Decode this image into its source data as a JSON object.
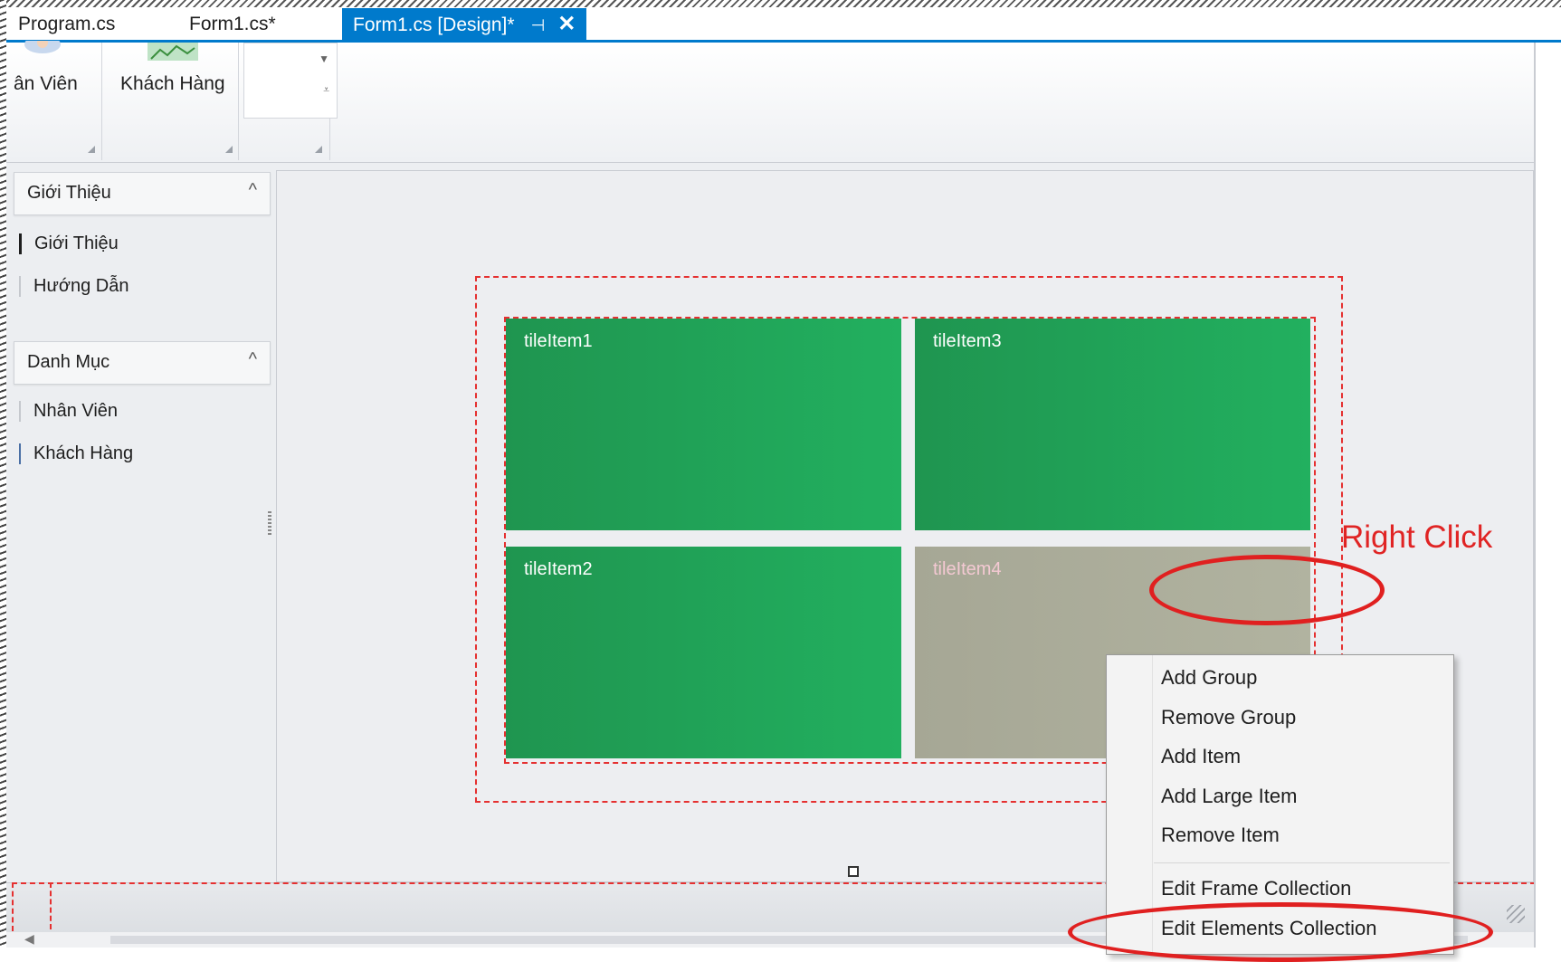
{
  "tabs": [
    {
      "label": "Program.cs"
    },
    {
      "label": "Form1.cs*"
    },
    {
      "label": "Form1.cs [Design]*",
      "pin_icon": "⊣",
      "close_icon": "✕"
    }
  ],
  "ribbon": {
    "button1_label": "ân Viên",
    "button2_label": "Khách Hàng",
    "gallery_up_icon": "▼",
    "gallery_more_icon": "⩡"
  },
  "nav": {
    "groups": [
      {
        "label": "Giới Thiệu",
        "collapse_icon": "^",
        "items": [
          "Giới Thiệu",
          "Hướng Dẫn"
        ]
      },
      {
        "label": "Danh Mục",
        "collapse_icon": "^",
        "items": [
          "Nhân Viên",
          "Khách Hàng"
        ]
      }
    ]
  },
  "tiles": [
    {
      "label": "tileItem1"
    },
    {
      "label": "tileItem3"
    },
    {
      "label": "tileItem2"
    },
    {
      "label": "tileItem4"
    }
  ],
  "annotation": {
    "text": "Right Click",
    "color": "#e02424"
  },
  "context_menu": {
    "items": [
      "Add Group",
      "Remove Group",
      "Add Item",
      "Add Large Item",
      "Remove Item",
      "Edit Frame Collection",
      "Edit Elements Collection"
    ]
  },
  "colors": {
    "accent": "#007acc",
    "tile_green": "#22b05f",
    "tile_gray": "#b1b3a0",
    "designer_dash": "#e53030"
  },
  "scroll": {
    "left_arrow": "◀"
  }
}
